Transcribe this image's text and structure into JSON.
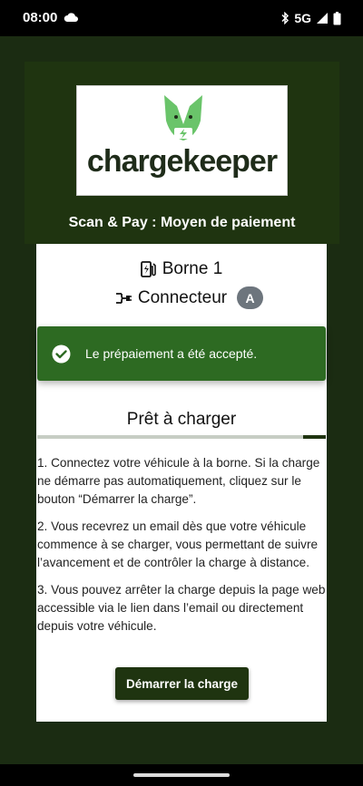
{
  "status_bar": {
    "time": "08:00",
    "weather_icon": "cloud-icon",
    "network": "5G",
    "icons": [
      "bluetooth-icon",
      "signal-icon",
      "battery-icon"
    ]
  },
  "header": {
    "logo_text": "chargekeeper",
    "subtitle": "Scan & Pay : Moyen de paiement"
  },
  "station": {
    "borne_label": "Borne 1",
    "connector_label": "Connecteur",
    "connector_id": "A"
  },
  "alert": {
    "message": "Le prépaiement a été accepté."
  },
  "status": {
    "title": "Prêt à charger",
    "progress": 0.92
  },
  "instructions": [
    "1. Connectez votre véhicule à la borne. Si la charge ne démarre pas automatiquement, cliquez sur le bouton “Démarrer la charge”.",
    "2. Vous recevrez un email dès que votre véhicule commence à se charger, vous permettant de suivre l’avancement et de contrôler la charge à distance.",
    "3. Vous pouvez arrêter la charge depuis la page web accessible via le lien dans l’email ou directement depuis votre véhicule."
  ],
  "actions": {
    "start_label": "Démarrer la charge"
  },
  "colors": {
    "brand_dark": "#1f3410",
    "brand_green": "#6ac46a",
    "success": "#2d6a22"
  }
}
